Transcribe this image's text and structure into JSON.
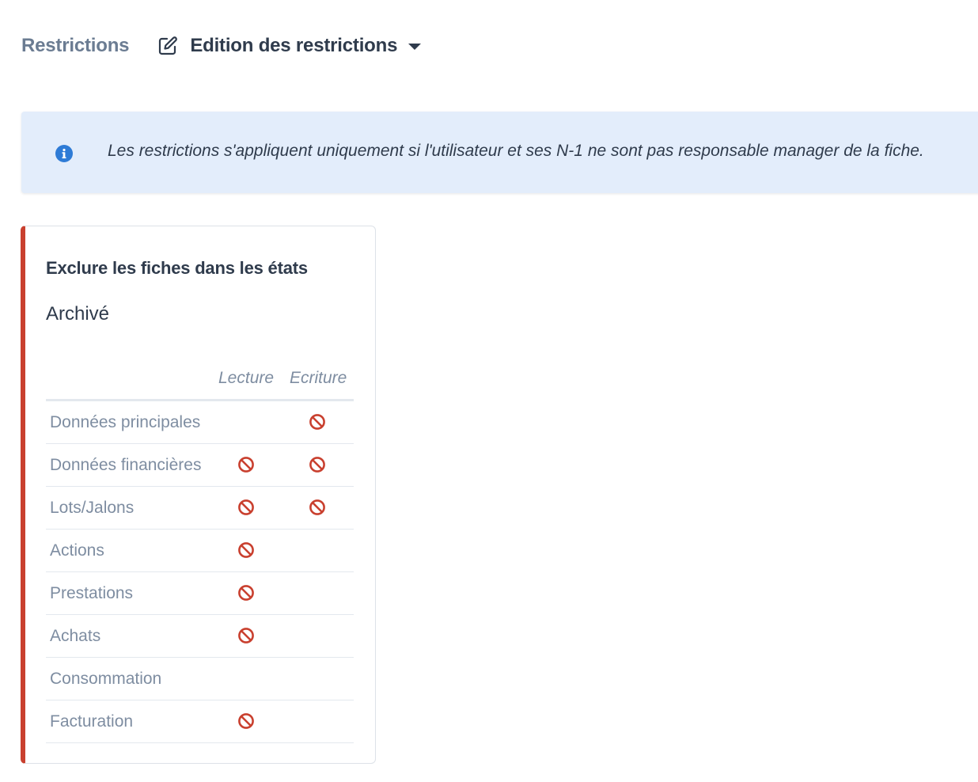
{
  "header": {
    "breadcrumb": "Restrictions",
    "edit_menu_label": "Edition des restrictions",
    "edit_icon": "edit-icon",
    "dropdown_icon": "caret-down-icon"
  },
  "info": {
    "icon": "info-circle-icon",
    "message": "Les restrictions s'appliquent uniquement si l'utilisateur et ses N-1 ne sont pas responsable manager de la fiche.",
    "background_color": "#e3edfb",
    "icon_color": "#2e7bd6"
  },
  "card": {
    "title": "Exclure les fiches dans les états",
    "state": "Archivé",
    "accent_color": "#c9402f",
    "columns": {
      "read": "Lecture",
      "write": "Ecriture"
    },
    "restricted_icon": "ban-icon",
    "rows": [
      {
        "label": "Données principales",
        "read": false,
        "write": true
      },
      {
        "label": "Données financières",
        "read": true,
        "write": true
      },
      {
        "label": "Lots/Jalons",
        "read": true,
        "write": true
      },
      {
        "label": "Actions",
        "read": true,
        "write": false
      },
      {
        "label": "Prestations",
        "read": true,
        "write": false
      },
      {
        "label": "Achats",
        "read": true,
        "write": false
      },
      {
        "label": "Consommation",
        "read": false,
        "write": false
      },
      {
        "label": "Facturation",
        "read": true,
        "write": false
      }
    ]
  }
}
